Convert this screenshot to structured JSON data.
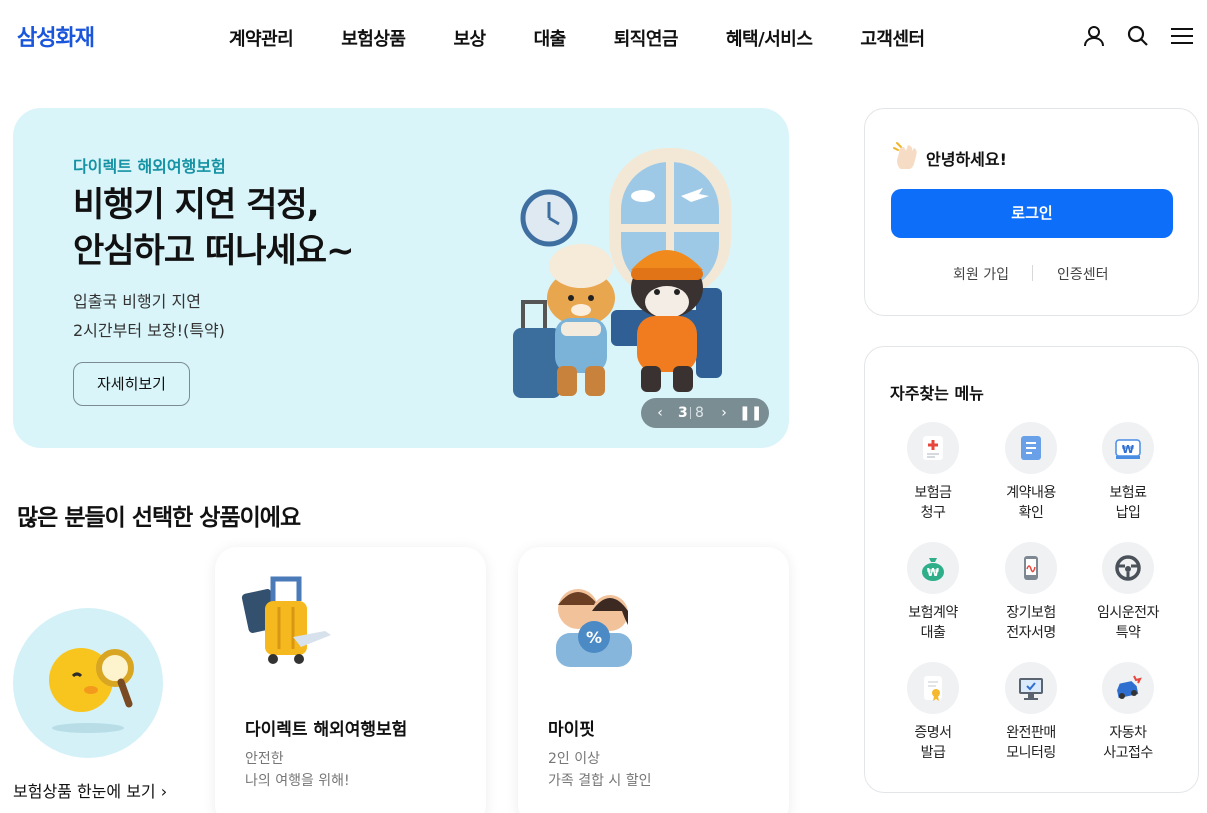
{
  "brand": {
    "logo": "삼성화재",
    "primary_color": "#0c6ef9",
    "logo_color": "#1a56db"
  },
  "nav": {
    "items": [
      "계약관리",
      "보험상품",
      "보상",
      "대출",
      "퇴직연금",
      "혜택/서비스",
      "고객센터"
    ],
    "icons": [
      "user-icon",
      "search-icon",
      "menu-icon"
    ]
  },
  "hero": {
    "eyebrow": "다이렉트 해외여행보험",
    "title_line1": "비행기 지연 걱정,",
    "title_line2": "안심하고 떠나세요~",
    "desc_line1": "입출국 비행기 지연",
    "desc_line2": "2시간부터 보장!(특약)",
    "button": "자세히보기",
    "pager": {
      "current": "3",
      "total": "8"
    },
    "background": "#d9f5fa"
  },
  "popular": {
    "title": "많은 분들이 선택한 상품이에요",
    "all_link": "보험상품 한눈에 보기",
    "cards": [
      {
        "title": "다이렉트 해외여행보험",
        "desc1": "안전한",
        "desc2": "나의 여행을 위해!"
      },
      {
        "title": "마이핏",
        "desc1": "2인 이상",
        "desc2": "가족 결합 시 할인"
      }
    ]
  },
  "login": {
    "greeting": "안녕하세요!",
    "button": "로그인",
    "join": "회원 가입",
    "cert": "인증센터"
  },
  "quick_menu": {
    "title": "자주찾는 메뉴",
    "items": [
      {
        "line1": "보험금",
        "line2": "청구",
        "icon": "medical-claim-icon"
      },
      {
        "line1": "계약내용",
        "line2": "확인",
        "icon": "document-icon"
      },
      {
        "line1": "보험료",
        "line2": "납입",
        "icon": "won-card-icon"
      },
      {
        "line1": "보험계약",
        "line2": "대출",
        "icon": "money-bag-icon"
      },
      {
        "line1": "장기보험",
        "line2": "전자서명",
        "icon": "phone-sign-icon"
      },
      {
        "line1": "임시운전자",
        "line2": "특약",
        "icon": "steering-wheel-icon"
      },
      {
        "line1": "증명서",
        "line2": "발급",
        "icon": "certificate-icon"
      },
      {
        "line1": "완전판매",
        "line2": "모니터링",
        "icon": "monitor-icon"
      },
      {
        "line1": "자동차",
        "line2": "사고접수",
        "icon": "car-accident-icon"
      }
    ]
  }
}
